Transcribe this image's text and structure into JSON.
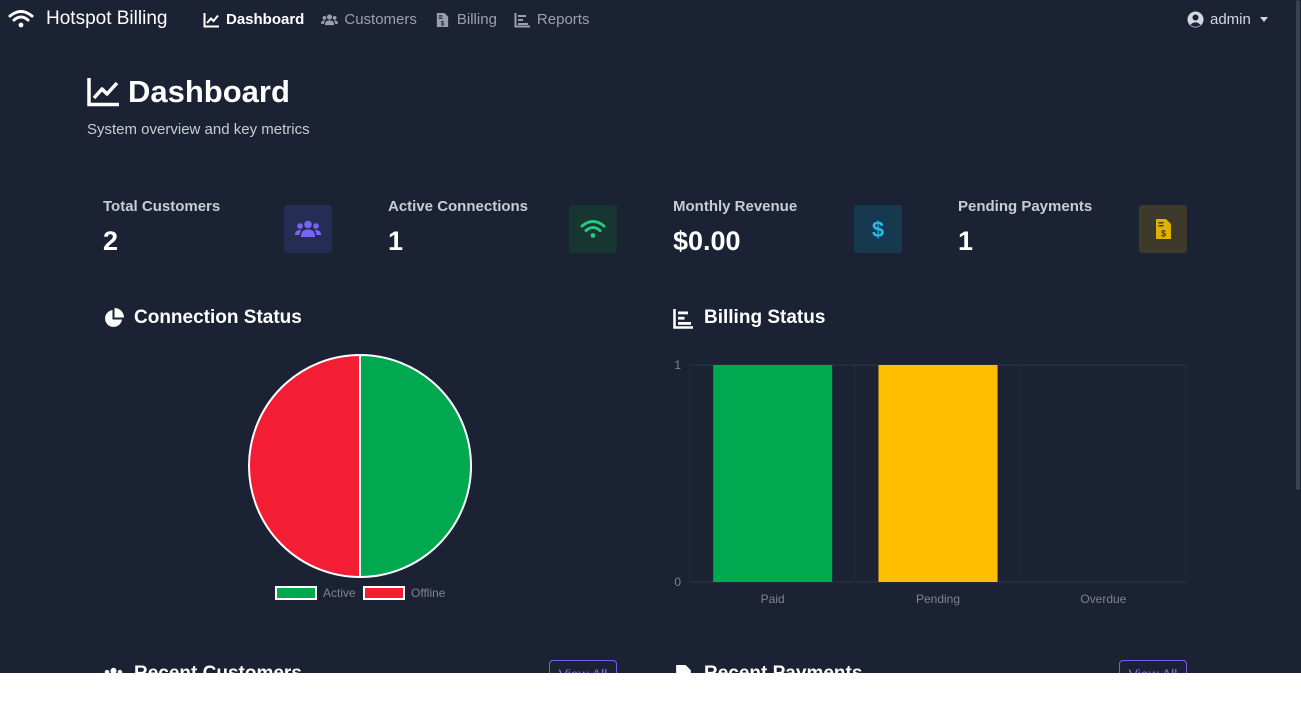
{
  "navbar": {
    "brand": "Hotspot Billing",
    "items": [
      {
        "label": "Dashboard",
        "icon": "chart-line-icon",
        "active": true
      },
      {
        "label": "Customers",
        "icon": "users-icon",
        "active": false
      },
      {
        "label": "Billing",
        "icon": "invoice-icon",
        "active": false
      },
      {
        "label": "Reports",
        "icon": "chart-bar-icon",
        "active": false
      }
    ],
    "user": "admin"
  },
  "header": {
    "title": "Dashboard",
    "subtitle": "System overview and key metrics"
  },
  "stats": [
    {
      "label": "Total Customers",
      "value": "2",
      "icon": "users-icon",
      "color": "#6f5cf0"
    },
    {
      "label": "Active Connections",
      "value": "1",
      "icon": "wifi-icon",
      "color": "#1fc07a"
    },
    {
      "label": "Monthly Revenue",
      "value": "$0.00",
      "icon": "dollar-icon",
      "color": "#25b8e6"
    },
    {
      "label": "Pending Payments",
      "value": "1",
      "icon": "invoice-icon",
      "color": "#e2b100"
    }
  ],
  "connection_status": {
    "title": "Connection Status"
  },
  "billing_status": {
    "title": "Billing Status"
  },
  "chart_data": [
    {
      "type": "pie",
      "title": "Connection Status",
      "categories": [
        "Active",
        "Offline"
      ],
      "values": [
        1,
        1
      ],
      "colors": [
        "#00a84f",
        "#f41e34"
      ],
      "legend": "bottom"
    },
    {
      "type": "bar",
      "title": "Billing Status",
      "categories": [
        "Paid",
        "Pending",
        "Overdue"
      ],
      "values": [
        1,
        1,
        0
      ],
      "colors": [
        "#00a84f",
        "#ffbe00",
        "#f41e34"
      ],
      "ylim": [
        0,
        1
      ],
      "yticks": [
        "0",
        "1"
      ],
      "grid": true,
      "legend": "none"
    }
  ],
  "recent_customers": {
    "title": "Recent Customers",
    "view_all": "View All"
  },
  "recent_payments": {
    "title": "Recent Payments",
    "view_all": "View All"
  }
}
